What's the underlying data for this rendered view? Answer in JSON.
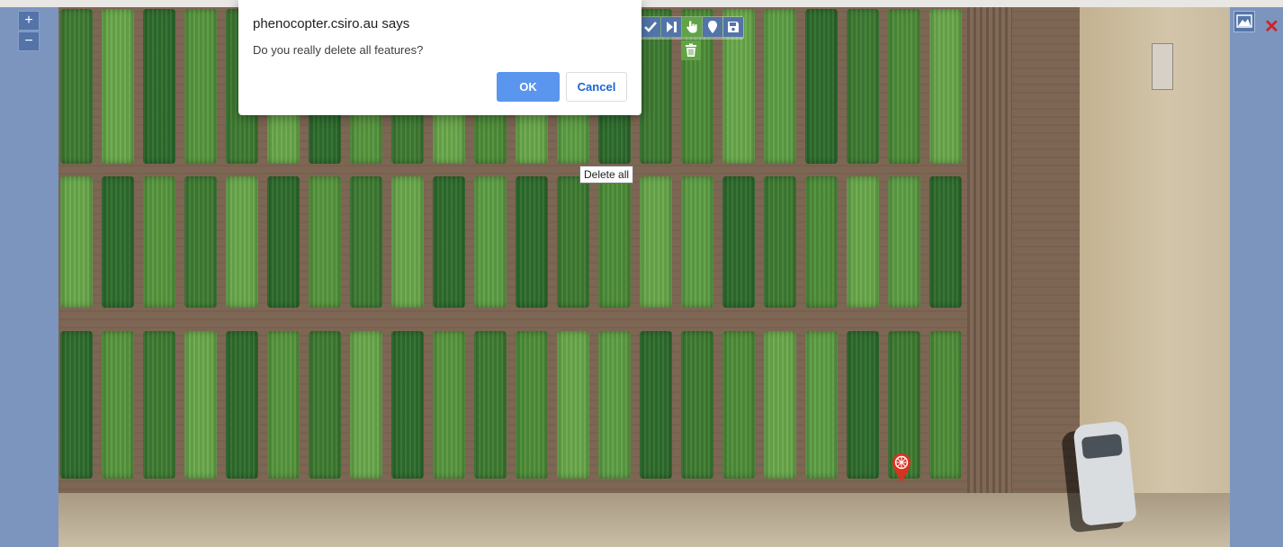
{
  "dialog": {
    "title": "phenocopter.csiro.au says",
    "message": "Do you really delete all features?",
    "ok_label": "OK",
    "cancel_label": "Cancel"
  },
  "map": {
    "zoom_in_label": "+",
    "zoom_out_label": "−",
    "tooltip_text": "Delete all",
    "close_label": "✕"
  },
  "toolbar": {
    "tools": [
      {
        "icon": "check-icon",
        "active": false
      },
      {
        "icon": "skip-icon",
        "active": false
      },
      {
        "icon": "hand-pointer-icon",
        "active": true
      },
      {
        "icon": "marker-icon",
        "active": false
      },
      {
        "icon": "save-icon",
        "active": false
      }
    ],
    "delete_icon": "trash-icon"
  },
  "colors": {
    "map_frame": "#7b95bf",
    "tool_blue": "#5274a8",
    "tool_green": "#62a348",
    "ok_blue": "#5a95ee",
    "marker_red": "#d9321f"
  }
}
